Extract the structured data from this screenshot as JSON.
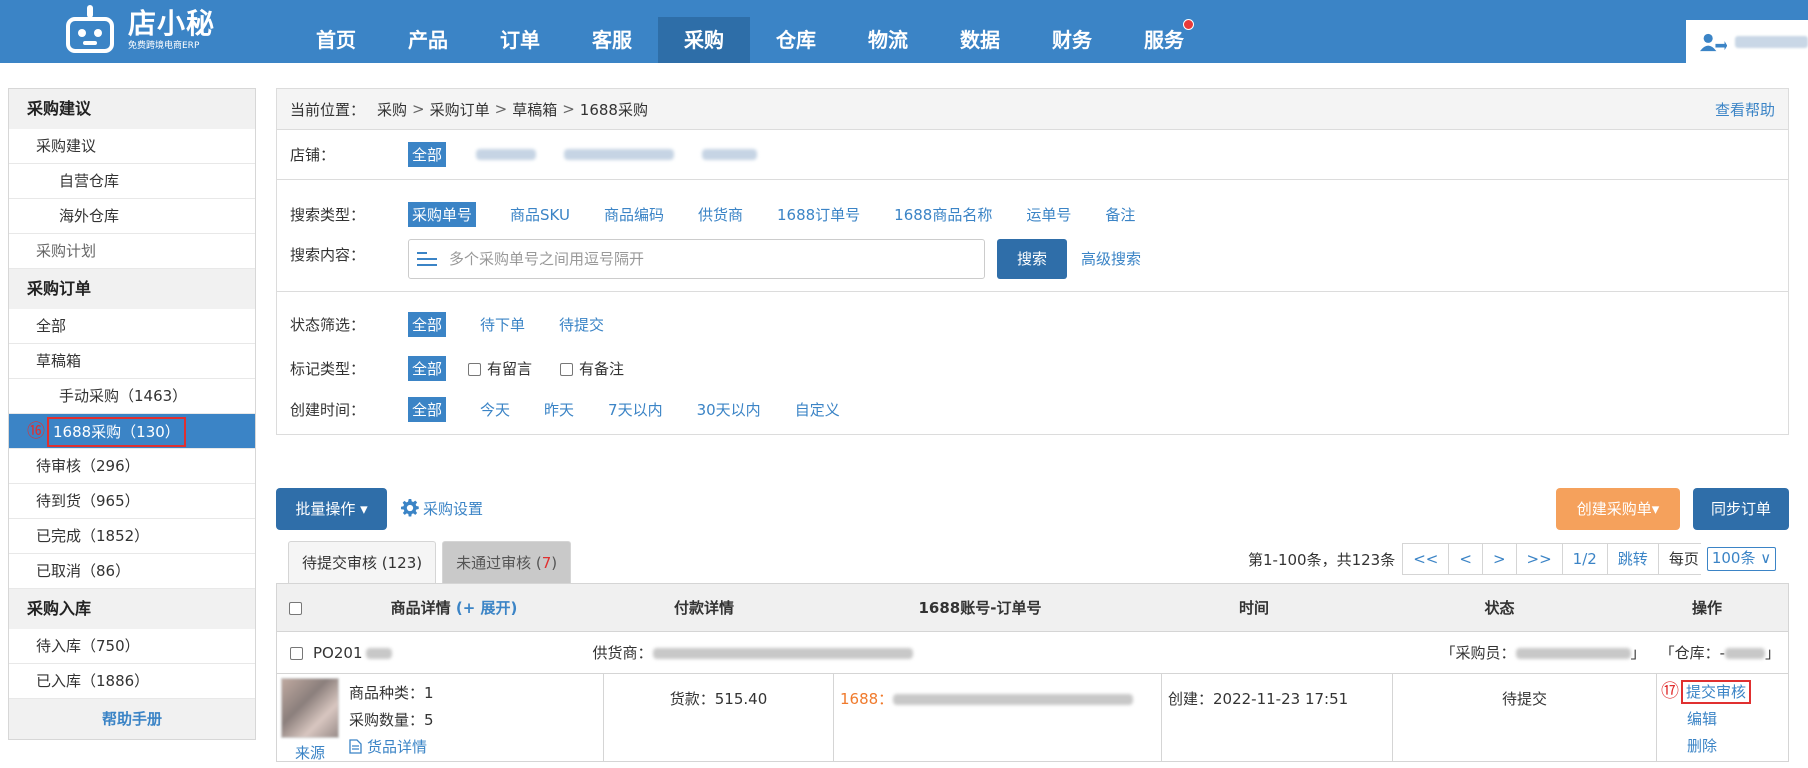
{
  "app": {
    "logo_title": "店小秘",
    "logo_subtitle": "免费跨境电商ERP"
  },
  "nav": {
    "items": [
      "首页",
      "产品",
      "订单",
      "客服",
      "采购",
      "仓库",
      "物流",
      "数据",
      "财务",
      "服务"
    ],
    "active": "采购"
  },
  "sidebar": {
    "group1": "采购建议",
    "item_suggest": "采购建议",
    "item_own_wh": "自营仓库",
    "item_overseas_wh": "海外仓库",
    "item_plan": "采购计划",
    "group2": "采购订单",
    "item_all": "全部",
    "item_draft": "草稿箱",
    "item_manual": "手动采购（1463）",
    "active_marker": "⑯",
    "item_1688": "1688采购（130）",
    "item_pending_review": "待审核（296）",
    "item_pending_arrival": "待到货（965）",
    "item_completed": "已完成（1852）",
    "item_cancelled": "已取消（86）",
    "group3": "采购入库",
    "item_pending_in": "待入库（750）",
    "item_stocked": "已入库（1886）",
    "help": "帮助手册"
  },
  "breadcrumb": {
    "prefix": "当前位置：",
    "path": [
      "采购",
      "采购订单",
      "草稿箱",
      "1688采购"
    ],
    "separator": ">",
    "help_link": "查看帮助"
  },
  "filters": {
    "store_label": "店铺：",
    "store_all": "全部",
    "search_type_label": "搜索类型：",
    "search_types": [
      "采购单号",
      "商品SKU",
      "商品编码",
      "供货商",
      "1688订单号",
      "1688商品名称",
      "运单号",
      "备注"
    ],
    "search_content_label": "搜索内容：",
    "search_placeholder": "多个采购单号之间用逗号隔开",
    "search_button": "搜索",
    "advanced_search": "高级搜索",
    "status_label": "状态筛选：",
    "status_options": [
      "全部",
      "待下单",
      "待提交"
    ],
    "mark_label": "标记类型：",
    "mark_all": "全部",
    "mark_message": "有留言",
    "mark_remark": "有备注",
    "time_label": "创建时间：",
    "time_options": [
      "全部",
      "今天",
      "昨天",
      "7天以内",
      "30天以内",
      "自定义"
    ]
  },
  "toolbar": {
    "batch": "批量操作 ▾",
    "settings": "采购设置",
    "create": "创建采购单▾",
    "sync": "同步订单"
  },
  "tabs": {
    "tab1": "待提交审核 (123)",
    "tab2_label": "未通过审核 (",
    "tab2_count": "7",
    "tab2_close": ")"
  },
  "pager": {
    "info": "第1-100条，共123条",
    "first": "<<",
    "prev": "<",
    "next": ">",
    "last": ">>",
    "page": "1/2",
    "jump": "跳转",
    "per_page_label": "每页",
    "per_page_value": "100条 ∨"
  },
  "table": {
    "headers": {
      "product": "商品详情",
      "expand": "(+ 展开)",
      "payment": "付款详情",
      "account": "1688账号-订单号",
      "time": "时间",
      "status": "状态",
      "action": "操作"
    },
    "group": {
      "po": "PO201",
      "supplier_label": "供货商：",
      "buyer_label": "「采购员：",
      "buyer_close": "」",
      "warehouse_label": "「仓库：-",
      "warehouse_close": "」"
    },
    "row": {
      "kinds": "商品种类：1",
      "qty": "采购数量：5",
      "goods_detail": "货品详情",
      "source": "来源",
      "payment": "货款：515.40",
      "account_prefix": "1688：",
      "created": "创建：2022-11-23 17:51",
      "status": "待提交",
      "action_marker": "⑰",
      "action_submit": "提交审核",
      "action_edit": "编辑",
      "action_delete": "删除"
    }
  },
  "colors": {
    "primary": "#3b84c6",
    "dark_primary": "#2f6ea9",
    "orange": "#f5a15c",
    "alert": "#e03030"
  }
}
